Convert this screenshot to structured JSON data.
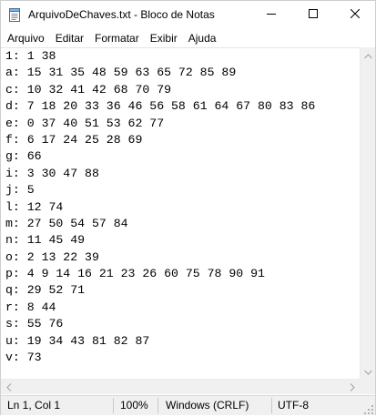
{
  "window": {
    "title": "ArquivoDeChaves.txt - Bloco de Notas",
    "buttons": {
      "minimize": "minimize",
      "maximize": "maximize",
      "close": "close"
    }
  },
  "menu": {
    "items": [
      "Arquivo",
      "Editar",
      "Formatar",
      "Exibir",
      "Ajuda"
    ]
  },
  "editor": {
    "lines": [
      "1: 1 38",
      "a: 15 31 35 48 59 63 65 72 85 89",
      "c: 10 32 41 42 68 70 79",
      "d: 7 18 20 33 36 46 56 58 61 64 67 80 83 86",
      "e: 0 37 40 51 53 62 77",
      "f: 6 17 24 25 28 69",
      "g: 66",
      "i: 3 30 47 88",
      "j: 5",
      "l: 12 74",
      "m: 27 50 54 57 84",
      "n: 11 45 49",
      "o: 2 13 22 39",
      "p: 4 9 14 16 21 23 26 60 75 78 90 91",
      "q: 29 52 71",
      "r: 8 44",
      "s: 55 76",
      "u: 19 34 43 81 82 87",
      "v: 73"
    ]
  },
  "statusbar": {
    "position": "Ln 1, Col 1",
    "zoom": "100%",
    "line_ending": "Windows (CRLF)",
    "encoding": "UTF-8"
  },
  "icons": {
    "app": "notepad-icon",
    "minimize": "minimize-icon",
    "maximize": "maximize-icon",
    "close": "close-icon"
  }
}
